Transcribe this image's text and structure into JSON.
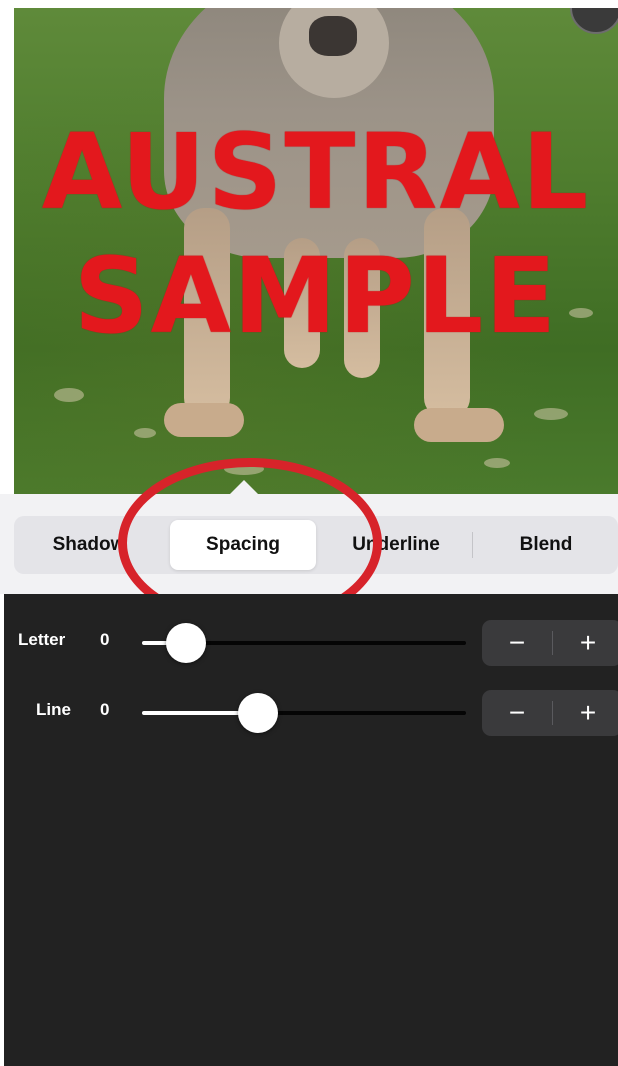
{
  "canvas": {
    "overlay_lines": [
      "AUSTRAL",
      "SAMPLE"
    ],
    "text_color": "#e3181d"
  },
  "tabs": [
    {
      "label": "Shadow",
      "active": false
    },
    {
      "label": "Spacing",
      "active": true
    },
    {
      "label": "Underline",
      "active": false
    },
    {
      "label": "Blend",
      "active": false
    }
  ],
  "controls": [
    {
      "label": "Letter",
      "value": "0",
      "level": 0.14
    },
    {
      "label": "Line",
      "value": "0",
      "level": 0.36
    }
  ],
  "stepper": {
    "minus_icon": "minus-icon",
    "plus_icon": "plus-icon",
    "minus": "−",
    "plus": "+"
  },
  "highlight": {
    "color": "#d7232a"
  },
  "colors": {
    "panel": "#222222",
    "tabbar": "#f2f2f4",
    "accent": "#e3181d"
  }
}
